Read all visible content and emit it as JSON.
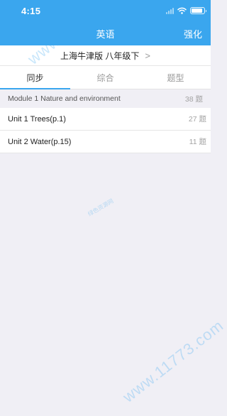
{
  "status_bar": {
    "time": "4:15"
  },
  "nav": {
    "title": "英语",
    "action_label": "强化"
  },
  "textbook": {
    "label": "上海牛津版 八年级下",
    "chevron": ">"
  },
  "tabs": [
    {
      "label": "同步",
      "active": true
    },
    {
      "label": "综合",
      "active": false
    },
    {
      "label": "题型",
      "active": false
    }
  ],
  "module": {
    "title": "Module 1 Nature and environment",
    "count": "38 题"
  },
  "units": [
    {
      "title": "Unit 1 Trees(p.1)",
      "count": "27 题"
    },
    {
      "title": "Unit 2 Water(p.15)",
      "count": "11 题"
    }
  ],
  "watermark": {
    "text": "www.11773.com",
    "mid_text": "绿色资源网"
  },
  "colors": {
    "header_bg": "#3aa6ee",
    "page_bg": "#f0eff5",
    "tab_indicator": "#3aa6ee"
  }
}
